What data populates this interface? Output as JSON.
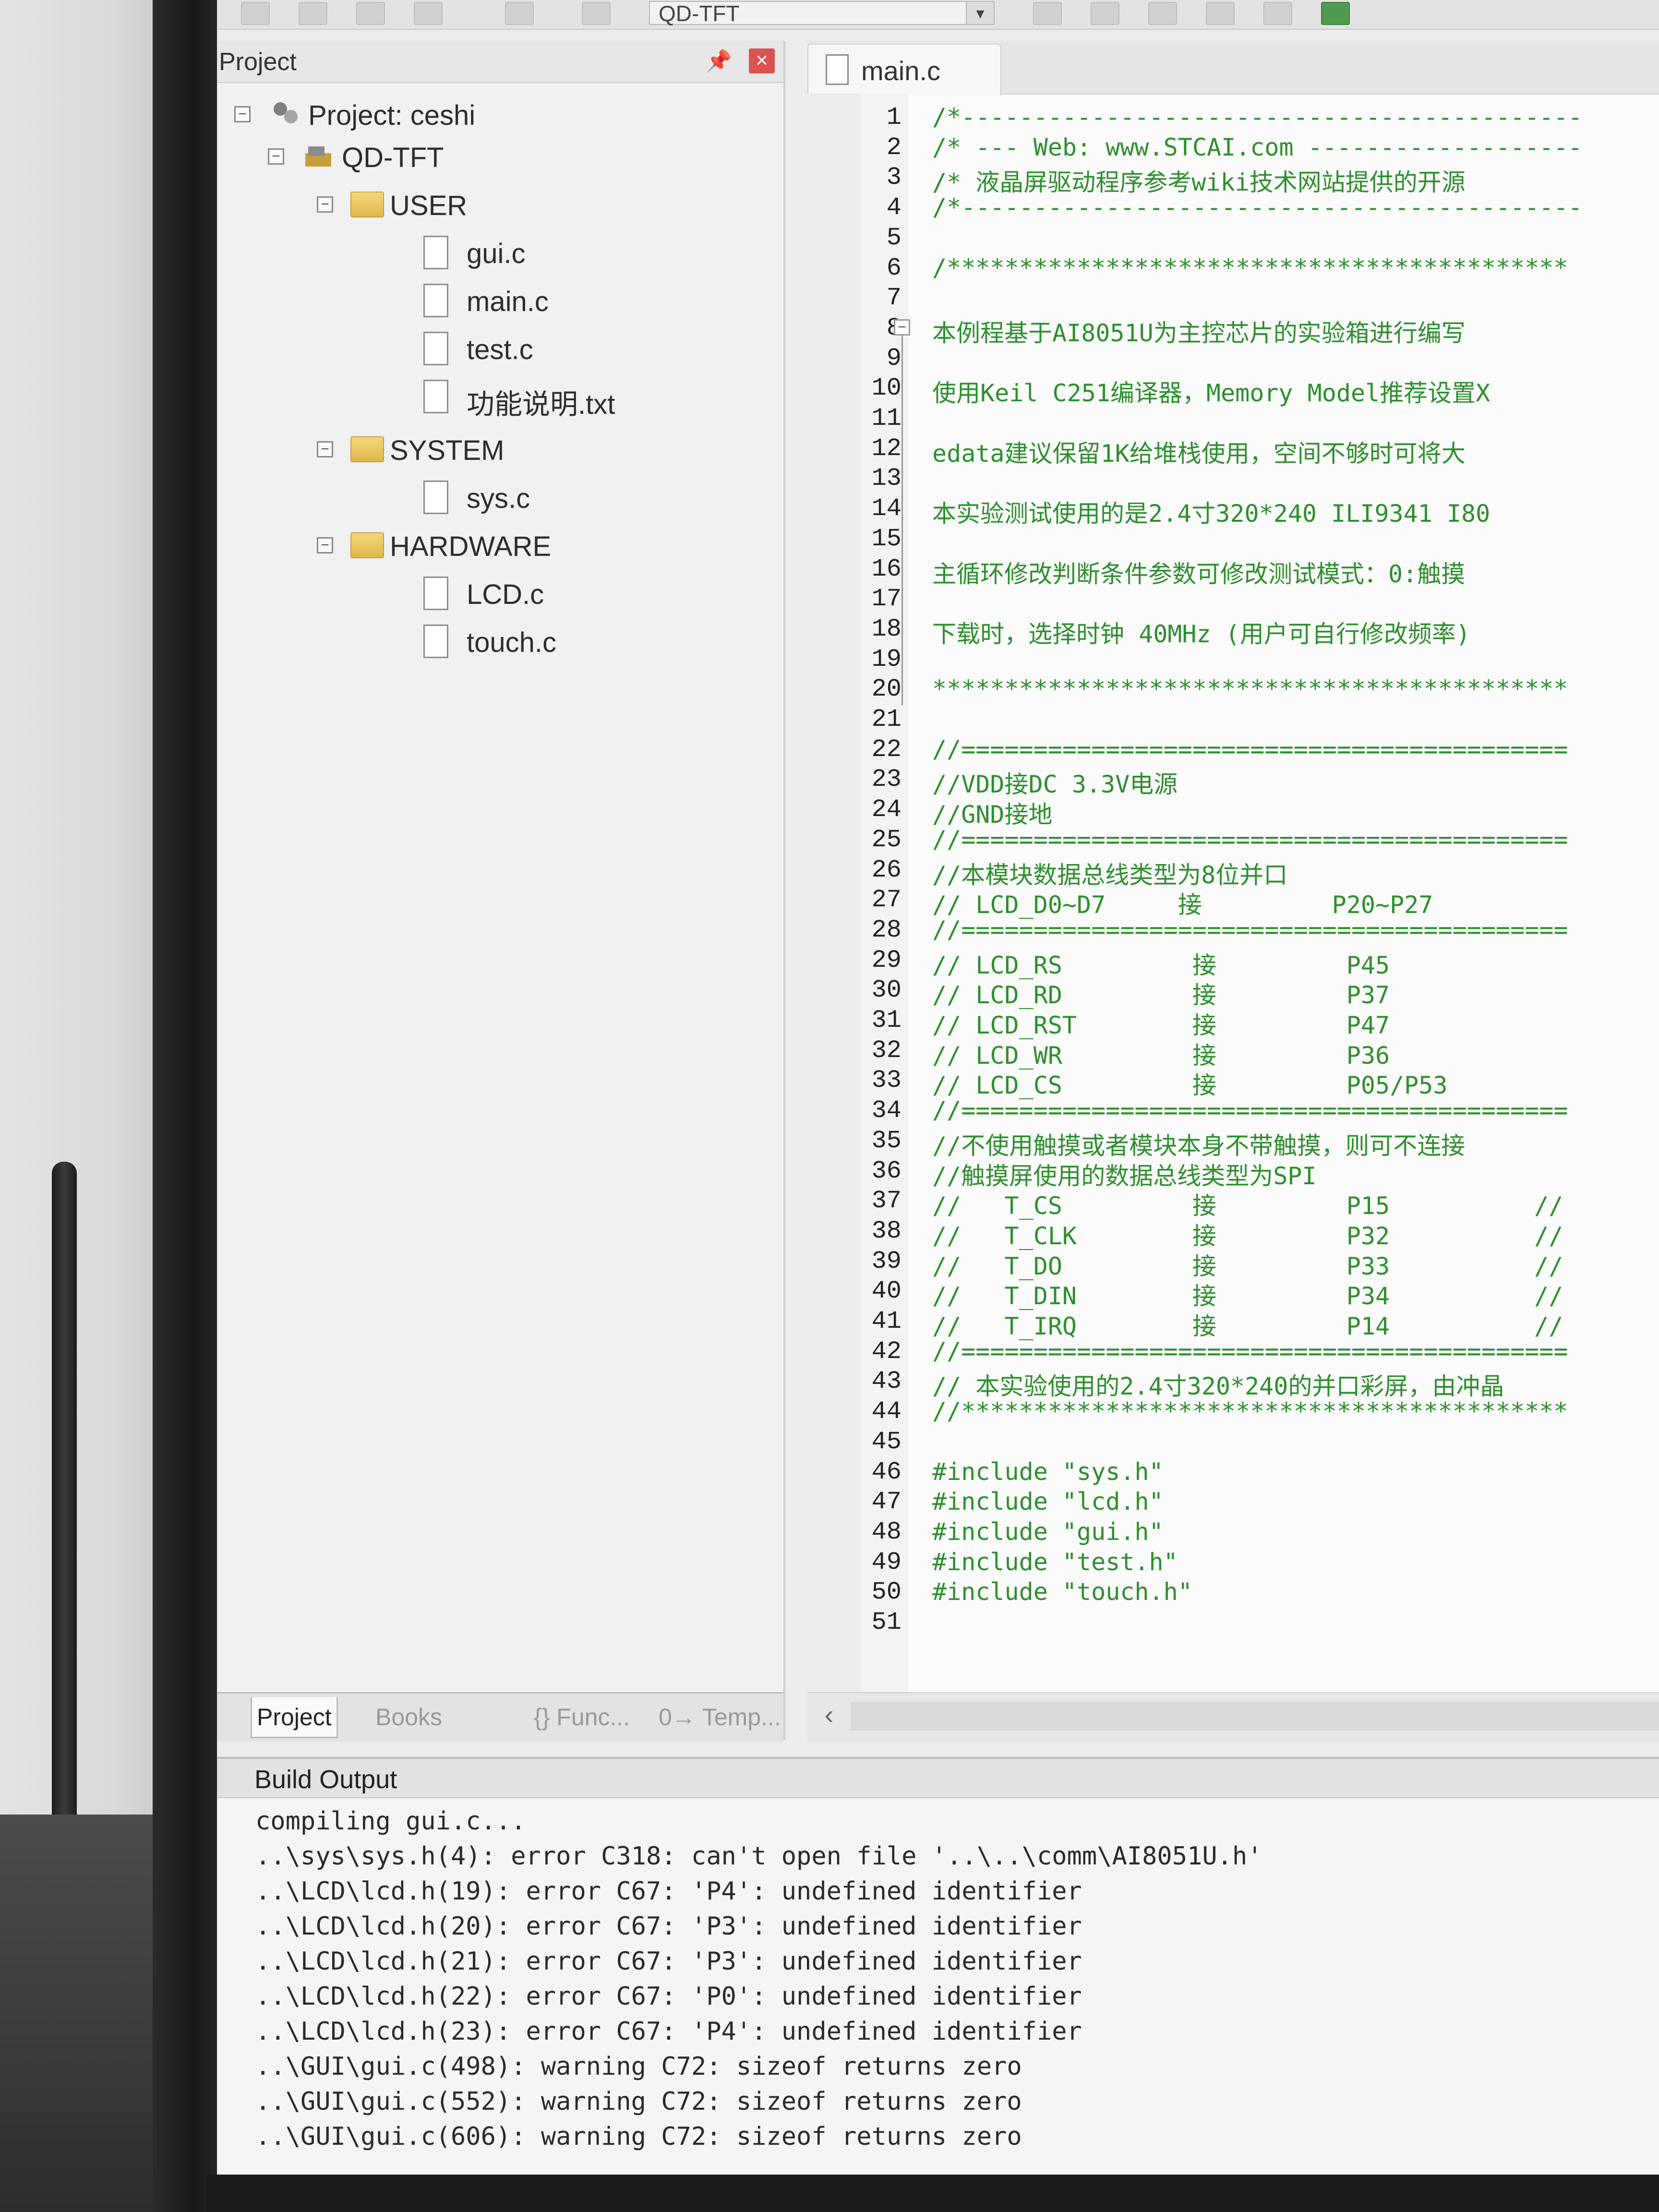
{
  "toolbar": {
    "target": "QD-TFT"
  },
  "project": {
    "pane_title": "Project",
    "tree": {
      "root": "Project: ceshi",
      "target": "QD-TFT",
      "groups": [
        {
          "name": "USER",
          "files": [
            "gui.c",
            "main.c",
            "test.c",
            "功能说明.txt"
          ]
        },
        {
          "name": "SYSTEM",
          "files": [
            "sys.c"
          ]
        },
        {
          "name": "HARDWARE",
          "files": [
            "LCD.c",
            "touch.c"
          ]
        }
      ]
    },
    "tabs": [
      "Project",
      "Books",
      "{} Func...",
      "0→ Temp..."
    ]
  },
  "editor": {
    "tab": "main.c",
    "lines": [
      "/*-------------------------------------------",
      "/* --- Web: www.STCAI.com -------------------",
      "/* 液晶屏驱动程序参考wiki技术网站提供的开源",
      "/*-------------------------------------------",
      "",
      "/*******************************************",
      "",
      "本例程基于AI8051U为主控芯片的实验箱进行编写",
      "",
      "使用Keil C251编译器，Memory Model推荐设置X",
      "",
      "edata建议保留1K给堆栈使用，空间不够时可将大",
      "",
      "本实验测试使用的是2.4寸320*240 ILI9341 I80",
      "",
      "主循环修改判断条件参数可修改测试模式：0:触摸",
      "",
      "下载时，选择时钟 40MHz (用户可自行修改频率)",
      "",
      "********************************************",
      "",
      "//==========================================",
      "//VDD接DC 3.3V电源",
      "//GND接地",
      "//==========================================",
      "//本模块数据总线类型为8位并口",
      "// LCD_D0~D7     接         P20~P27",
      "//==========================================",
      "// LCD_RS         接         P45",
      "// LCD_RD         接         P37",
      "// LCD_RST        接         P47",
      "// LCD_WR         接         P36",
      "// LCD_CS         接         P05/P53",
      "//==========================================",
      "//不使用触摸或者模块本身不带触摸，则可不连接",
      "//触摸屏使用的数据总线类型为SPI",
      "//   T_CS         接         P15          //",
      "//   T_CLK        接         P32          //",
      "//   T_DO         接         P33          //",
      "//   T_DIN        接         P34          //",
      "//   T_IRQ        接         P14          //",
      "//==========================================",
      "// 本实验使用的2.4寸320*240的并口彩屏，由冲晶",
      "//******************************************",
      "",
      "#include \"sys.h\"",
      "#include \"lcd.h\"",
      "#include \"gui.h\"",
      "#include \"test.h\"",
      "#include \"touch.h\"",
      ""
    ]
  },
  "build": {
    "title": "Build Output",
    "lines": [
      "compiling gui.c...",
      "..\\sys\\sys.h(4): error C318: can't open file '..\\..\\comm\\AI8051U.h'",
      "..\\LCD\\lcd.h(19): error C67: 'P4': undefined identifier",
      "..\\LCD\\lcd.h(20): error C67: 'P3': undefined identifier",
      "..\\LCD\\lcd.h(21): error C67: 'P3': undefined identifier",
      "..\\LCD\\lcd.h(22): error C67: 'P0': undefined identifier",
      "..\\LCD\\lcd.h(23): error C67: 'P4': undefined identifier",
      "..\\GUI\\gui.c(498): warning C72: sizeof returns zero",
      "..\\GUI\\gui.c(552): warning C72: sizeof returns zero",
      "..\\GUI\\gui.c(606): warning C72: sizeof returns zero"
    ]
  },
  "icons": {
    "pin": "pin-icon",
    "close": "close-icon",
    "folder": "folder-icon",
    "file": "file-icon"
  },
  "colors": {
    "code_green": "#2e8f2e",
    "close_red": "#d9534f"
  }
}
